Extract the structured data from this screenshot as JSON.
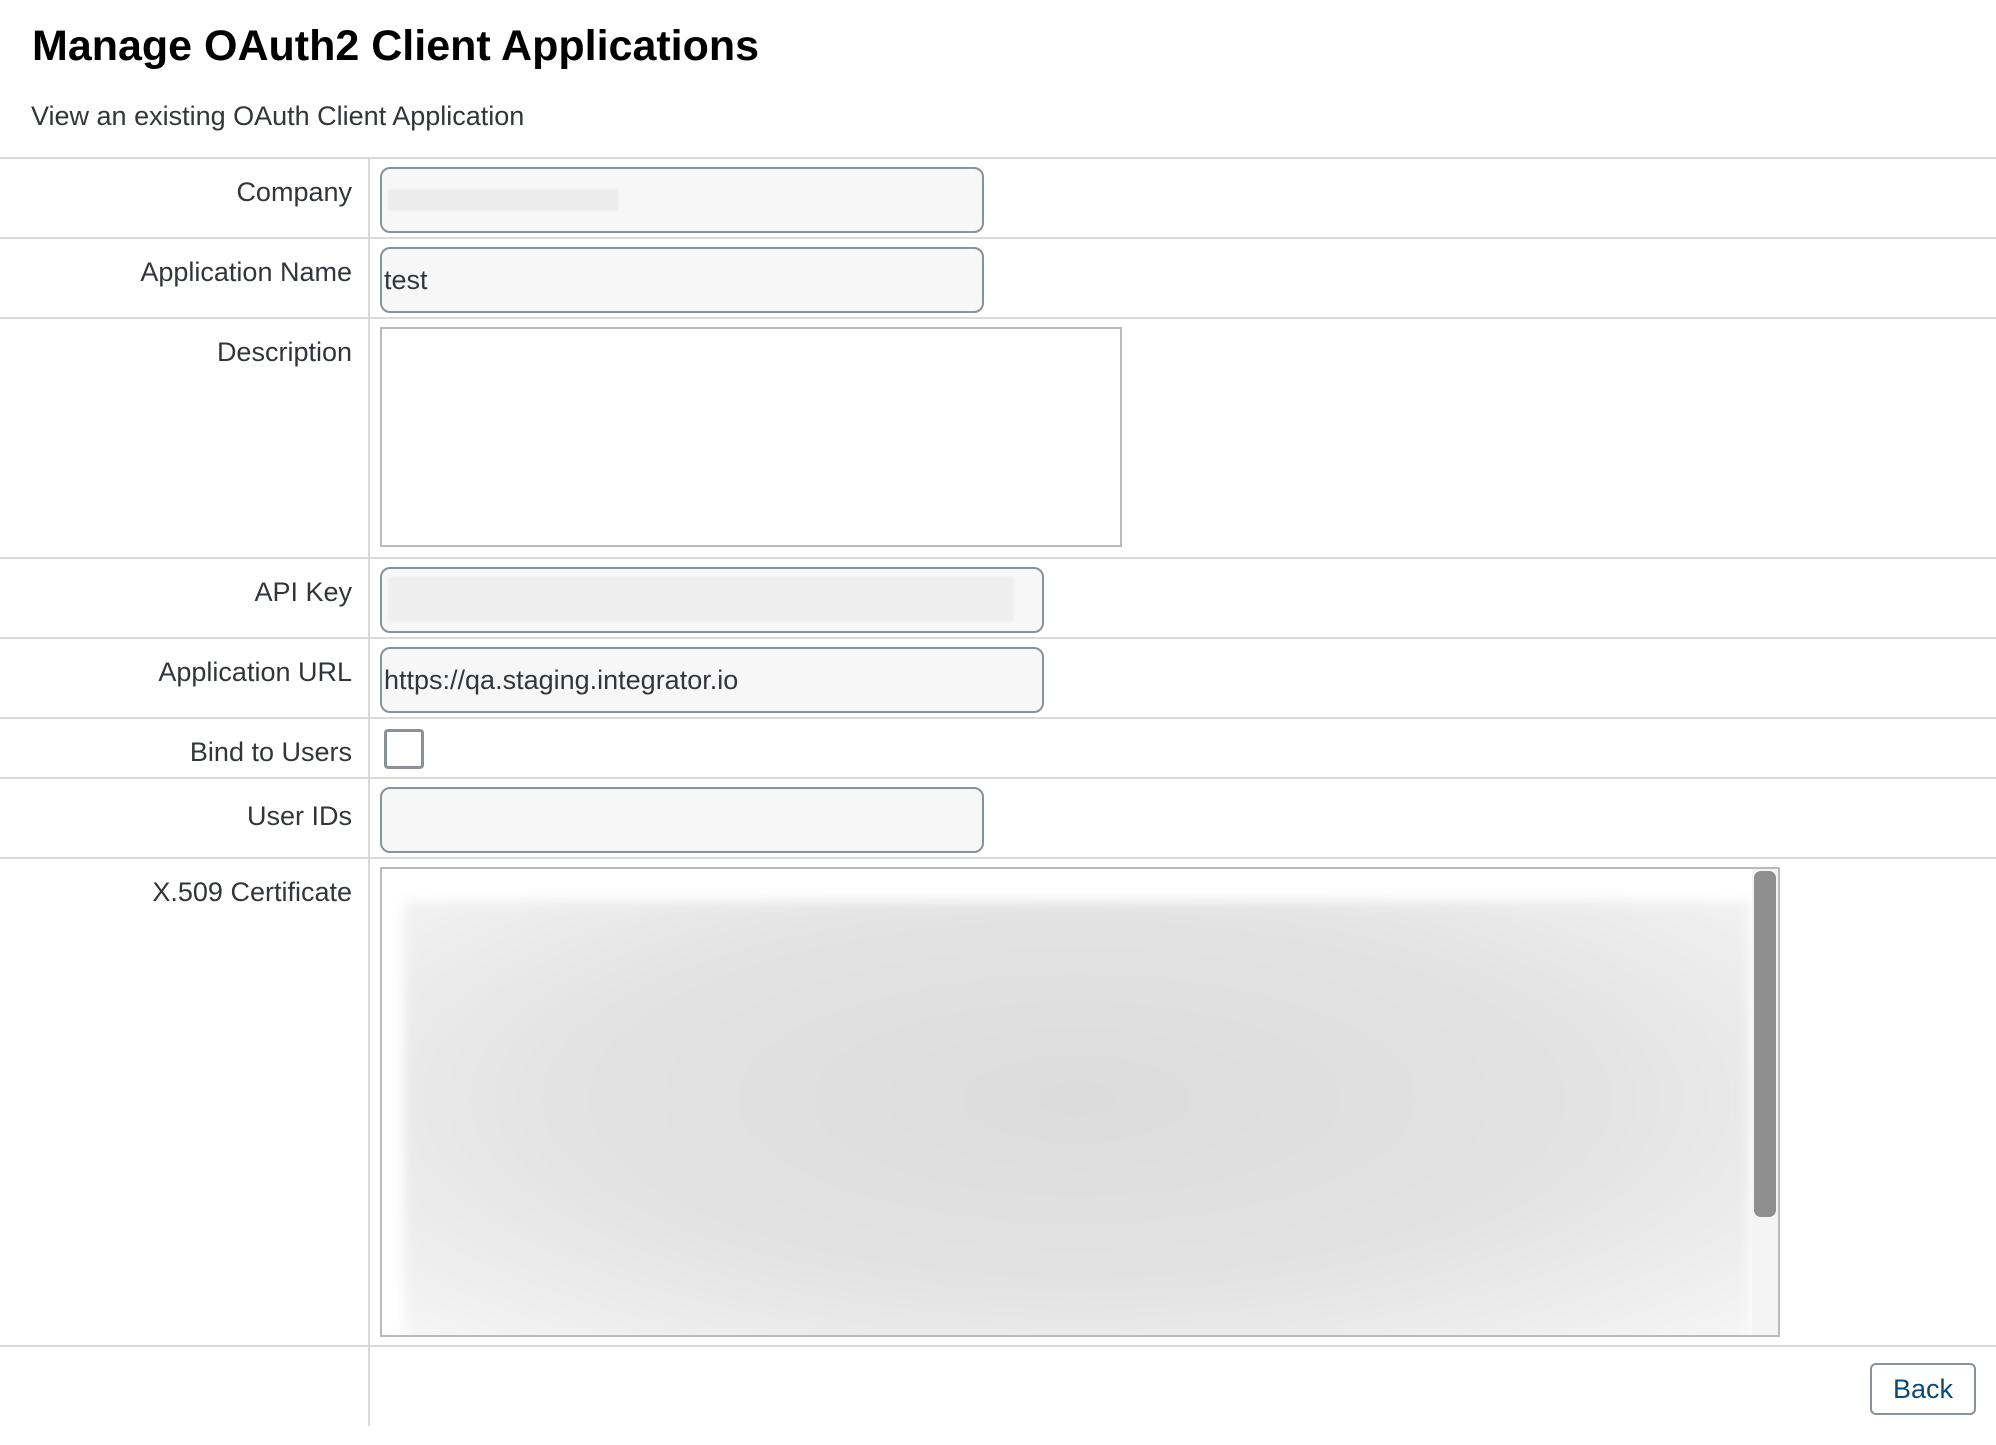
{
  "page": {
    "title": "Manage OAuth2 Client Applications",
    "subtitle": "View an existing OAuth Client Application"
  },
  "form": {
    "company": {
      "label": "Company",
      "value": ""
    },
    "application_name": {
      "label": "Application Name",
      "value": "test"
    },
    "description": {
      "label": "Description",
      "value": ""
    },
    "api_key": {
      "label": "API Key",
      "value": ""
    },
    "application_url": {
      "label": "Application URL",
      "value": "https://qa.staging.integrator.io"
    },
    "bind_to_users": {
      "label": "Bind to Users",
      "checked": false
    },
    "user_ids": {
      "label": "User IDs",
      "value": ""
    },
    "certificate": {
      "label": "X.509 Certificate",
      "value": ""
    }
  },
  "actions": {
    "back_label": "Back"
  },
  "colors": {
    "border": "#89919a",
    "divider": "#d9d9d9",
    "link_text": "#0a4a7a",
    "input_bg": "#f7f7f7"
  }
}
